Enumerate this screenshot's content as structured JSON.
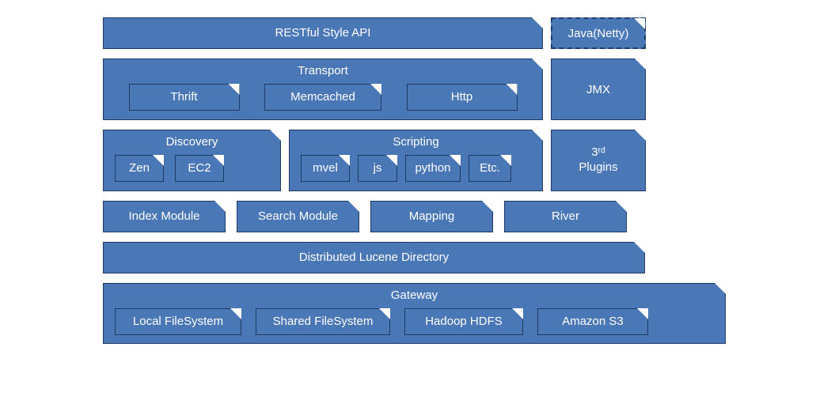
{
  "row1": {
    "api": "RESTful Style API",
    "java": "Java(Netty)"
  },
  "row2": {
    "transport": {
      "title": "Transport",
      "items": [
        "Thrift",
        "Memcached",
        "Http"
      ]
    },
    "jmx": "JMX"
  },
  "row3": {
    "discovery": {
      "title": "Discovery",
      "items": [
        "Zen",
        "EC2"
      ]
    },
    "scripting": {
      "title": "Scripting",
      "items": [
        "mvel",
        "js",
        "python",
        "Etc."
      ]
    },
    "plugins_top": "3ʳᵈ",
    "plugins_bottom": "Plugins"
  },
  "row4": {
    "items": [
      "Index Module",
      "Search Module",
      "Mapping",
      "River"
    ]
  },
  "row5": "Distributed Lucene Directory",
  "row6": {
    "title": "Gateway",
    "items": [
      "Local FileSystem",
      "Shared FileSystem",
      "Hadoop HDFS",
      "Amazon S3"
    ]
  }
}
